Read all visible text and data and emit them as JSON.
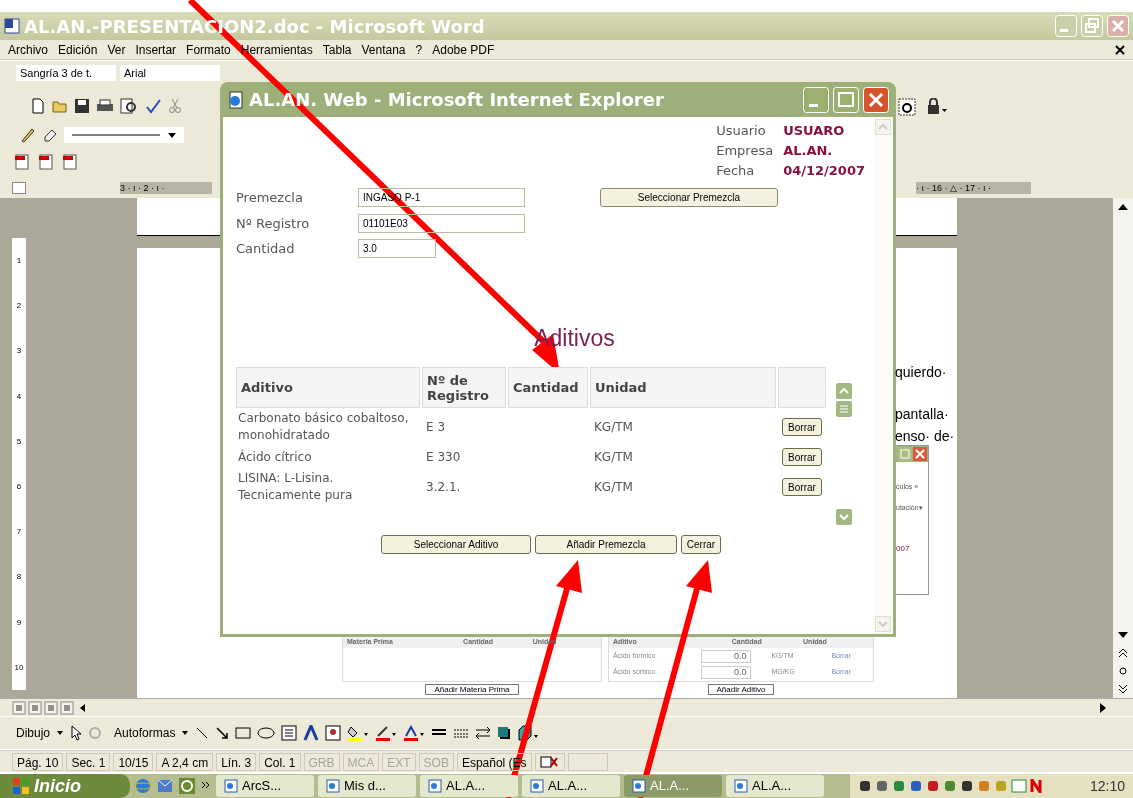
{
  "word": {
    "title": "AL.AN.-PRESENTACION2.doc - Microsoft Word",
    "menu": [
      "Archivo",
      "Edición",
      "Ver",
      "Insertar",
      "Formato",
      "Herramientas",
      "Tabla",
      "Ventana",
      "?",
      "Adobe PDF"
    ],
    "style_box": "Sangría 3 de t.",
    "font_box": "Arial",
    "ruler_left": "3 · ı · 2 · ı ·",
    "ruler_right": "· ı · 16 · △ · 17 · ı ·",
    "vertical_ruler": [
      "1",
      "2",
      "3",
      "4",
      "5",
      "6",
      "7",
      "8",
      "9",
      "10"
    ],
    "document_fragments": [
      "quierdo·",
      "pantalla·",
      "enso· de·"
    ]
  },
  "embedded_screenshot": {
    "peek_texts": [
      "culos »",
      "utación▾",
      "007"
    ],
    "left_columns": [
      "Materia Prima",
      "Cantidad",
      "Unidad"
    ],
    "left_button": "Añadir Materia Prima",
    "right_columns": [
      "Aditivo",
      "Cantidad",
      "Unidad"
    ],
    "right_rows": [
      {
        "name": "Ácido fórmico",
        "quantity": "0.0",
        "unit": "KG/TM",
        "action": "Borrar"
      },
      {
        "name": "Ácido sórbico",
        "quantity": "0.0",
        "unit": "MG/KG",
        "action": "Borrar"
      }
    ],
    "right_button": "Añadir Aditivo"
  },
  "browser_dialog": {
    "title": "AL.AN. Web - Microsoft Internet Explorer",
    "session": [
      {
        "label": "Usuario",
        "value": "USUARO"
      },
      {
        "label": "Empresa",
        "value": "AL.AN."
      },
      {
        "label": "Fecha",
        "value": "04/12/2007"
      }
    ],
    "fields": [
      {
        "label": "Premezcla",
        "value": "INGASO P-1"
      },
      {
        "label": "Nº Registro",
        "value": "01101E03"
      },
      {
        "label": "Cantidad",
        "value": "3.0"
      }
    ],
    "select_button": "Seleccionar Premezcla",
    "heading": "Aditivos",
    "columns": [
      "Aditivo",
      "Nº de Registro",
      "Cantidad",
      "Unidad"
    ],
    "rows": [
      {
        "aditivo": "Carbonato básico cobaltoso, monohidratado",
        "registro": "E 3",
        "cantidad": "",
        "unidad": "KG/TM",
        "action": "Borrar"
      },
      {
        "aditivo": "Ácido cítrico",
        "registro": "E 330",
        "cantidad": "",
        "unidad": "KG/TM",
        "action": "Borrar"
      },
      {
        "aditivo": "LISINA: L-Lisina. Tecnicamente pura",
        "registro": "3.2.1.",
        "cantidad": "",
        "unidad": "KG/TM",
        "action": "Borrar"
      }
    ],
    "buttons": [
      "Seleccionar Aditivo",
      "Añadir Premezcla",
      "Cerrar"
    ]
  },
  "drawing_toolbar": {
    "items": [
      "Dibujo",
      "Autoformas"
    ]
  },
  "status_bar": {
    "fields": [
      {
        "text": "Pág. 10",
        "disabled": false
      },
      {
        "text": "Sec. 1",
        "disabled": false
      },
      {
        "text": "10/15",
        "disabled": false
      },
      {
        "text": "A 2,4 cm",
        "disabled": false
      },
      {
        "text": "Lín. 3",
        "disabled": false
      },
      {
        "text": "Col. 1",
        "disabled": false
      },
      {
        "text": "GRB",
        "disabled": true
      },
      {
        "text": "MCA",
        "disabled": true
      },
      {
        "text": "EXT",
        "disabled": true
      },
      {
        "text": "SOB",
        "disabled": true
      },
      {
        "text": "Español (Es",
        "disabled": false
      }
    ]
  },
  "taskbar": {
    "start": "Inicio",
    "tasks": [
      {
        "label": "ArcS...",
        "selected": false
      },
      {
        "label": "Mis d...",
        "selected": false
      },
      {
        "label": "AL.A...",
        "selected": false
      },
      {
        "label": "AL.A...",
        "selected": false
      },
      {
        "label": "AL.A...",
        "selected": true
      },
      {
        "label": "AL.A...",
        "selected": false
      }
    ],
    "clock": "12:10"
  }
}
